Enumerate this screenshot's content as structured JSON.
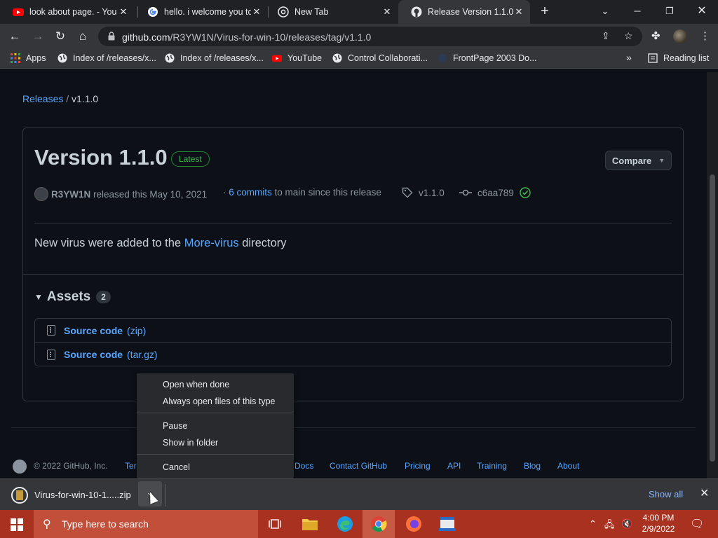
{
  "browser": {
    "tabs": [
      {
        "title": "look about page. - You",
        "icon": "youtube-icon",
        "active": false
      },
      {
        "title": "hello. i welcome you to",
        "icon": "google-icon",
        "active": false
      },
      {
        "title": "New Tab",
        "icon": "chrome-icon",
        "active": false
      },
      {
        "title": "Release Version 1.1.0 ·",
        "icon": "github-icon",
        "active": true
      }
    ],
    "new_tab_symbol": "+",
    "url_host": "github.com",
    "url_path": "/R3YW1N/Virus-for-win-10/releases/tag/v1.1.0",
    "bookmarks": [
      {
        "label": "Apps",
        "icon": "apps-grid-icon"
      },
      {
        "label": "Index of /releases/x...",
        "icon": "globe-icon"
      },
      {
        "label": "Index of /releases/x...",
        "icon": "globe-icon"
      },
      {
        "label": "YouTube",
        "icon": "youtube-icon"
      },
      {
        "label": "Control Collaborati...",
        "icon": "globe-icon"
      },
      {
        "label": "FrontPage 2003 Do...",
        "icon": "frontpage-icon"
      }
    ],
    "bookmarks_overflow": "»",
    "reading_list": "Reading list"
  },
  "page": {
    "breadcrumb_link": "Releases",
    "breadcrumb_sep": "/",
    "breadcrumb_current": "v1.1.0",
    "title": "Version 1.1.0",
    "badge": "Latest",
    "compare_label": "Compare",
    "author": "R3YW1N",
    "released_text": "released this May 10, 2021",
    "commits_prefix": "·",
    "commits_link": "6 commits",
    "commits_suffix": "to main since this release",
    "tag": "v1.1.0",
    "commit_hash": "c6aa789",
    "description_before": "New virus were added to the",
    "description_link": "More-virus",
    "description_after": "directory",
    "assets_label": "Assets",
    "assets_count": "2",
    "assets": [
      {
        "name": "Source code",
        "ext": "(zip)"
      },
      {
        "name": "Source code",
        "ext": "(tar.gz)"
      }
    ],
    "footer": {
      "copyright": "© 2022 GitHub, Inc.",
      "terms_partial": "Ter",
      "links": [
        "Docs",
        "Contact GitHub",
        "Pricing",
        "API",
        "Training",
        "Blog",
        "About"
      ]
    }
  },
  "context_menu": {
    "items": [
      "Open when done",
      "Always open files of this type",
      "Pause",
      "Show in folder",
      "Cancel"
    ]
  },
  "download_shelf": {
    "filename": "Virus-for-win-10-1.....zip",
    "show_all": "Show all"
  },
  "taskbar": {
    "search_placeholder": "Type here to search",
    "time": "4:00 PM",
    "date": "2/9/2022",
    "colors": {
      "taskbar": "#a8311f",
      "search": "#c24f39"
    }
  }
}
